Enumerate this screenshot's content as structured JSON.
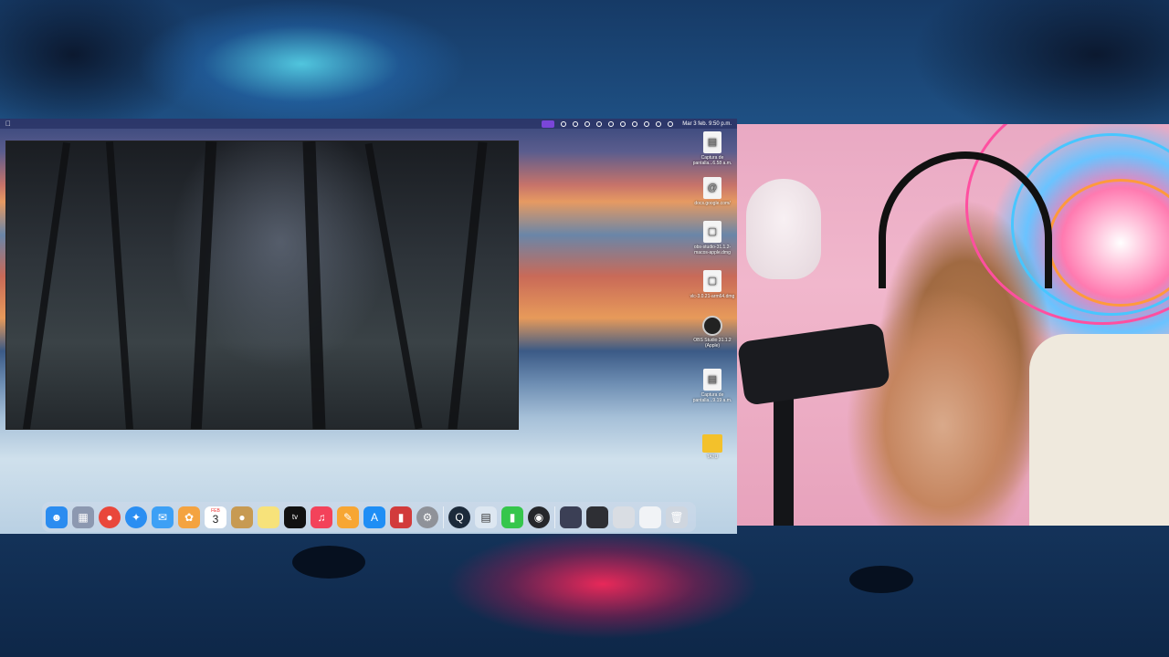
{
  "menubar": {
    "apple": "",
    "clock": "Mar 3 feb.  9:50 p.m."
  },
  "desktop": {
    "icons": [
      {
        "name": "Captura de pantalla...6.58 a.m.",
        "icon": "screenshot-file-icon"
      },
      {
        "name": "docs.google.com/",
        "icon": "weblink-icon"
      },
      {
        "name": "obs-studio-31.1.2-macos-apple.dmg",
        "icon": "dmg-file-icon"
      },
      {
        "name": "vlc-3.0.21-arm64.dmg",
        "icon": "dmg-file-icon"
      },
      {
        "name": "OBS Studio 31.1.2 (Apple)",
        "icon": "obs-app-icon"
      },
      {
        "name": "Captura de pantalla...9.19 a.m.",
        "icon": "screenshot-file-icon"
      },
      {
        "name": "TATU",
        "icon": "folder-icon"
      }
    ]
  },
  "dock": {
    "calendar_day": "3",
    "calendar_month": "FEB",
    "tv_label": "tv",
    "apps": [
      {
        "id": "finder",
        "color": "#2b8cf0"
      },
      {
        "id": "launchpad",
        "color": "#8c98b0"
      },
      {
        "id": "chrome",
        "color": "#e9473b"
      },
      {
        "id": "safari",
        "color": "#2a8ef2"
      },
      {
        "id": "mail",
        "color": "#3da0f5"
      },
      {
        "id": "photos",
        "color": "#f4a340"
      },
      {
        "id": "calendar",
        "color": "#ffffff"
      },
      {
        "id": "keychain",
        "color": "#c79a52"
      },
      {
        "id": "notes",
        "color": "#f7e27a"
      },
      {
        "id": "apple-tv",
        "color": "#111111"
      },
      {
        "id": "music",
        "color": "#f3425a"
      },
      {
        "id": "pages",
        "color": "#f7a633"
      },
      {
        "id": "app-store",
        "color": "#1f8ef5"
      },
      {
        "id": "pdf-app",
        "color": "#d23b3b"
      },
      {
        "id": "system-settings",
        "color": "#8f9299"
      },
      {
        "id": "quicktime",
        "color": "#1c2a3a"
      },
      {
        "id": "preview",
        "color": "#dde7f1"
      },
      {
        "id": "numbers",
        "color": "#35c64c"
      },
      {
        "id": "obs",
        "color": "#25272b"
      },
      {
        "id": "recent-window-1",
        "color": "#3b3f55"
      },
      {
        "id": "recent-window-2",
        "color": "#2e2f34"
      },
      {
        "id": "recent-window-3",
        "color": "#d9dde3"
      },
      {
        "id": "recent-window-4",
        "color": "#f1f3f6"
      },
      {
        "id": "trash",
        "color": "#cfd6df"
      }
    ]
  }
}
